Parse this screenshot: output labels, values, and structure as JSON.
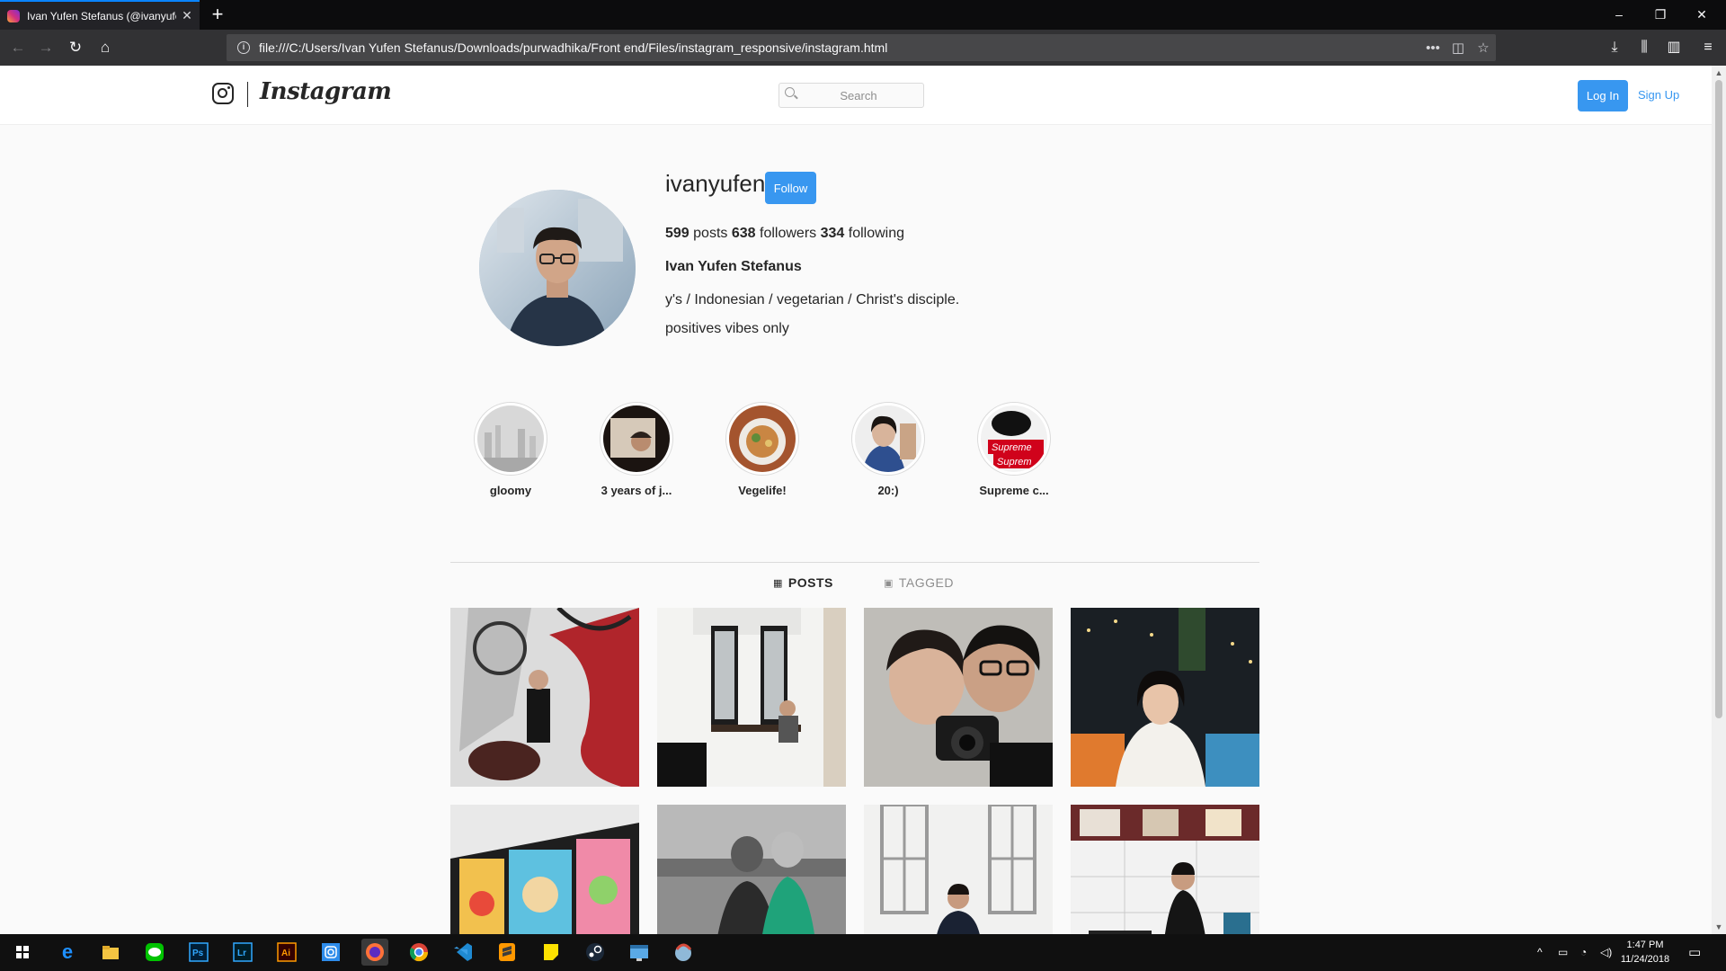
{
  "browser": {
    "tab_title": "Ivan Yufen Stefanus (@ivanyufen)",
    "tab_close": "✕",
    "new_tab": "+",
    "url": "file:///C:/Users/Ivan Yufen Stefanus/Downloads/purwadhika/Front end/Files/instagram_responsive/instagram.html"
  },
  "header": {
    "logo_text": "Instagram",
    "search_placeholder": "Search",
    "login_label": "Log In",
    "signup_label": "Sign Up"
  },
  "profile": {
    "username": "ivanyufen",
    "follow_label": "Follow",
    "posts_count": "599",
    "posts_label": "posts",
    "followers_count": "638",
    "followers_label": "followers",
    "following_count": "334",
    "following_label": "following",
    "full_name": "Ivan Yufen Stefanus",
    "bio_line1": "y's / Indonesian / vegetarian / Christ's disciple.",
    "bio_line2": "positives vibes only"
  },
  "highlights": [
    {
      "label": "gloomy"
    },
    {
      "label": "3 years of j..."
    },
    {
      "label": "Vegelife!"
    },
    {
      "label": "20:)"
    },
    {
      "label": "Supreme c..."
    }
  ],
  "highlight_sticker": [
    "Supreme",
    "Suprem"
  ],
  "profile_tabs": {
    "posts_label": "POSTS",
    "tagged_label": "TAGGED"
  },
  "colors": {
    "accent": "#3897f0",
    "text": "#262626",
    "muted": "#8e8e8e",
    "firefox_blue": "#0a84ff"
  },
  "taskbar": {
    "time": "1:47 PM",
    "date": "11/24/2018",
    "apps": [
      "windows-start",
      "edge",
      "file-explorer",
      "line",
      "photoshop",
      "lightroom",
      "illustrator",
      "instagram",
      "firefox",
      "chrome",
      "vscode",
      "sublime-text",
      "sticky-notes",
      "steam",
      "desktop-app",
      "game-app"
    ],
    "app_labels": {
      "ps": "Ps",
      "lr": "Lr",
      "ai": "Ai"
    }
  }
}
